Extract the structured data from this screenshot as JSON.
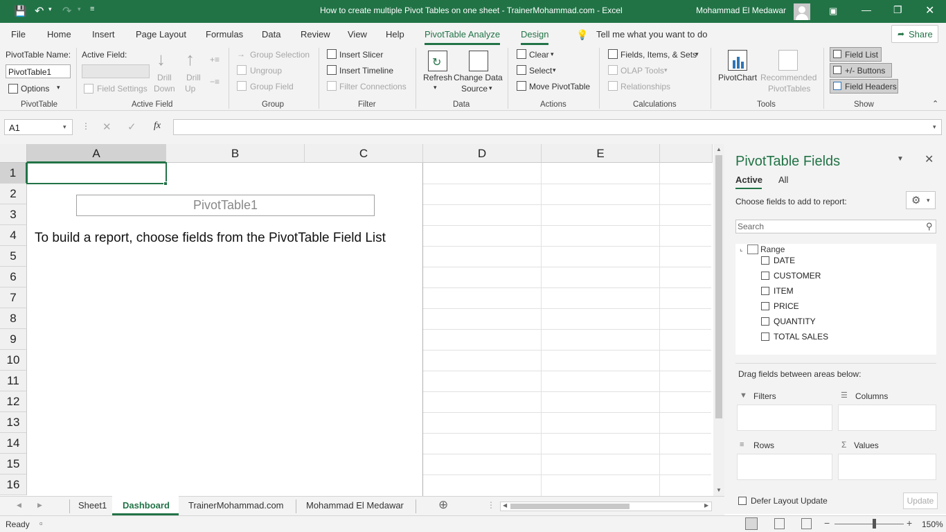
{
  "title_bar": {
    "document_title": "How to create multiple Pivot Tables on one sheet - TrainerMohammad.com  -  Excel",
    "user_name": "Mohammad El Medawar",
    "accent_color": "#217346"
  },
  "menu": {
    "file": "File",
    "home": "Home",
    "insert": "Insert",
    "page_layout": "Page Layout",
    "formulas": "Formulas",
    "data": "Data",
    "review": "Review",
    "view": "View",
    "help": "Help",
    "pivottable_analyze": "PivotTable Analyze",
    "design": "Design",
    "tell_me": "Tell me what you want to do",
    "share": "Share"
  },
  "ribbon": {
    "pivottable": {
      "name_label": "PivotTable Name:",
      "name_value": "PivotTable1",
      "options": "Options",
      "group": "PivotTable"
    },
    "active_field": {
      "label": "Active Field:",
      "field_settings": "Field Settings",
      "drill_down_1": "Drill",
      "drill_down_2": "Down",
      "drill_up_1": "Drill",
      "drill_up_2": "Up",
      "group": "Active Field"
    },
    "group": {
      "group_selection": "Group Selection",
      "ungroup": "Ungroup",
      "group_field": "Group Field",
      "group": "Group"
    },
    "filter": {
      "insert_slicer": "Insert Slicer",
      "insert_timeline": "Insert Timeline",
      "filter_connections": "Filter Connections",
      "group": "Filter"
    },
    "data": {
      "refresh": "Refresh",
      "change_data_1": "Change Data",
      "change_data_2": "Source",
      "group": "Data"
    },
    "actions": {
      "clear": "Clear",
      "select": "Select",
      "move_pivottable": "Move PivotTable",
      "group": "Actions"
    },
    "calculations": {
      "fields_items_sets": "Fields, Items, & Sets",
      "olap_tools": "OLAP Tools",
      "relationships": "Relationships",
      "group": "Calculations"
    },
    "tools": {
      "pivotchart": "PivotChart",
      "recommended_1": "Recommended",
      "recommended_2": "PivotTables",
      "group": "Tools"
    },
    "show": {
      "field_list": "Field List",
      "buttons": "+/- Buttons",
      "field_headers": "Field Headers",
      "group": "Show"
    }
  },
  "formula_bar": {
    "name_box": "A1",
    "fx": "fx",
    "formula": ""
  },
  "grid": {
    "columns": [
      "A",
      "B",
      "C",
      "D",
      "E"
    ],
    "rows": [
      "1",
      "2",
      "3",
      "4",
      "5",
      "6",
      "7",
      "8",
      "9",
      "10",
      "11",
      "12",
      "13",
      "14",
      "15",
      "16"
    ],
    "pivot_placeholder": "PivotTable1",
    "instruction": "To build a report, choose fields from the PivotTable Field List"
  },
  "panel": {
    "title": "PivotTable Fields",
    "tab_active": "Active",
    "tab_all": "All",
    "choose_label": "Choose fields to add to report:",
    "search_placeholder": "Search",
    "range_label": "Range",
    "fields": [
      "DATE",
      "CUSTOMER",
      "ITEM",
      "PRICE",
      "QUANTITY",
      "TOTAL SALES"
    ],
    "drag_label": "Drag fields between areas below:",
    "filters": "Filters",
    "columns": "Columns",
    "rows": "Rows",
    "values": "Values",
    "defer": "Defer Layout Update",
    "update": "Update"
  },
  "sheets": {
    "tabs": [
      "Sheet1",
      "Dashboard",
      "TrainerMohammad.com",
      "Mohammad El Medawar"
    ],
    "active": "Dashboard"
  },
  "status": {
    "ready": "Ready",
    "zoom": "150%"
  }
}
